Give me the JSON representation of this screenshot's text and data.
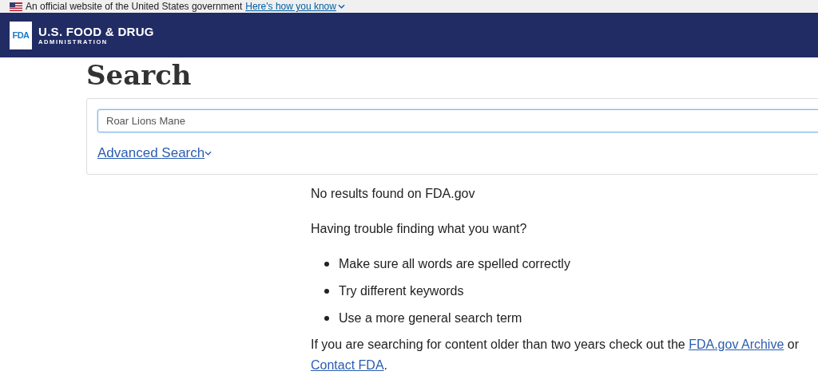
{
  "gov_banner": {
    "text": "An official website of the United States government",
    "link": "Here's how you know"
  },
  "header": {
    "logo_text": "FDA",
    "title": "U.S. FOOD & DRUG",
    "subtitle": "ADMINISTRATION"
  },
  "page_title": "Search",
  "search": {
    "value": "Roar Lions Mane",
    "advanced_link": "Advanced Search"
  },
  "results": {
    "message": "No results found on FDA.gov",
    "help_heading": "Having trouble finding what you want?",
    "tips": [
      "Make sure all words are spelled correctly",
      "Try different keywords",
      "Use a more general search term"
    ],
    "footer": {
      "text_before": "If you are searching for content older than two years check out the ",
      "archive_link": "FDA.gov Archive",
      "text_middle": " or ",
      "contact_link": "Contact FDA",
      "text_after": "."
    }
  }
}
